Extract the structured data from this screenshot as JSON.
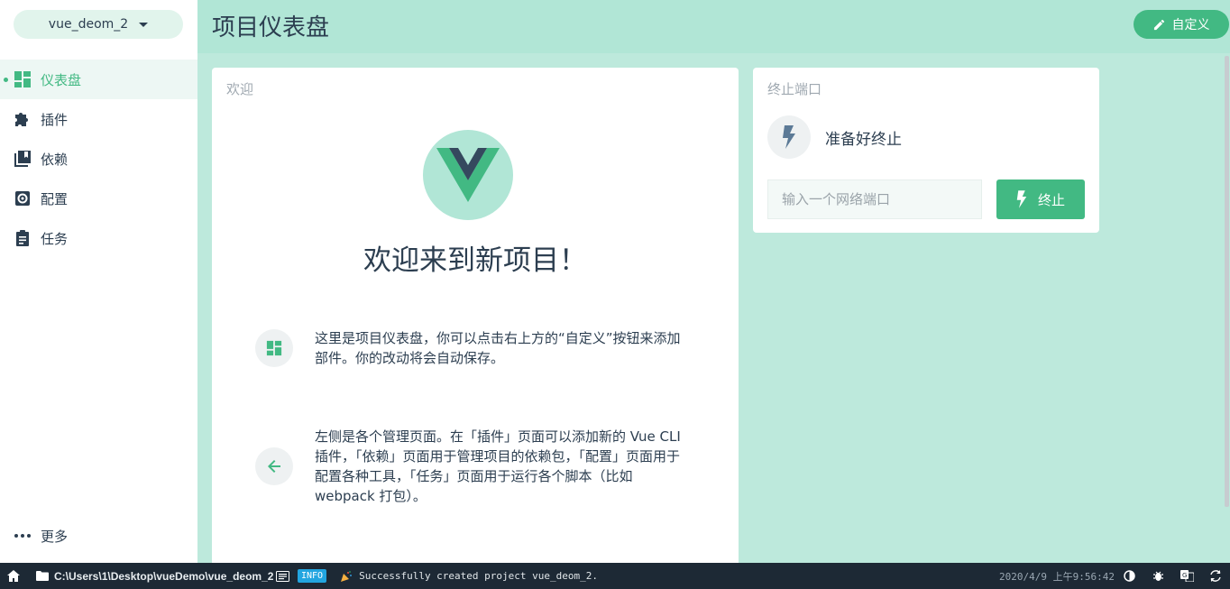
{
  "sidebar": {
    "project_name": "vue_deom_2",
    "items": [
      {
        "label": "仪表盘",
        "icon": "dashboard-icon",
        "active": true
      },
      {
        "label": "插件",
        "icon": "puzzle-icon",
        "active": false
      },
      {
        "label": "依赖",
        "icon": "library-icon",
        "active": false
      },
      {
        "label": "配置",
        "icon": "settings-icon",
        "active": false
      },
      {
        "label": "任务",
        "icon": "clipboard-icon",
        "active": false
      }
    ],
    "more_label": "更多"
  },
  "header": {
    "title": "项目仪表盘",
    "customize_label": "自定义"
  },
  "welcome": {
    "title": "欢迎",
    "heading": "欢迎来到新项目！",
    "tip1": "这里是项目仪表盘，你可以点击右上方的“自定义”按钮来添加部件。你的改动将会自动保存。",
    "tip2": "左侧是各个管理页面。在「插件」页面可以添加新的 Vue CLI 插件，「依赖」页面用于管理项目的依赖包，「配置」页面用于配置各种工具，「任务」页面用于运行各个脚本（比如 webpack 打包）。"
  },
  "kill_port": {
    "title": "终止端口",
    "status": "准备好终止",
    "input_placeholder": "输入一个网络端口",
    "input_value": "",
    "button_label": "终止"
  },
  "statusbar": {
    "path": "C:\\Users\\1\\Desktop\\vueDemo\\vue_deom_2",
    "badge": "INFO",
    "message": "Successfully created project vue_deom_2.",
    "time": "2020/4/9 上午9:56:42"
  },
  "colors": {
    "accent": "#42b983",
    "background": "#bde9dc",
    "header": "#b1e6d6",
    "statusbar": "#1d2935",
    "info": "#22a5e0"
  }
}
